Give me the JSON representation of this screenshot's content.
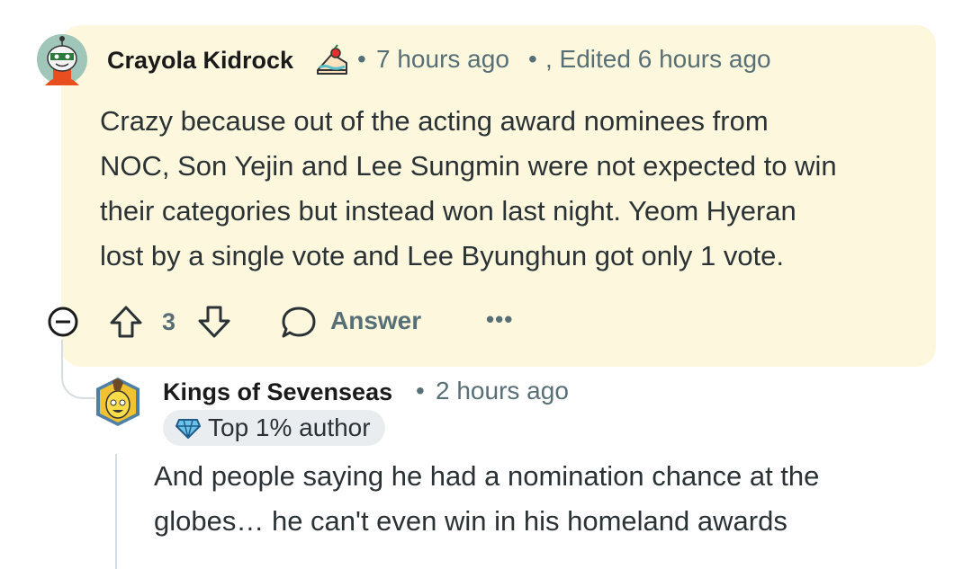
{
  "comment": {
    "author": "Crayola Kidrock",
    "separator": "•",
    "time": "7 hours ago",
    "edited": ", Edited 6 hours ago",
    "body_lines": [
      "Crazy because out of the acting award nominees from",
      "NOC, Son Yejin and Lee Sungmin were not expected to win",
      "their categories but instead won last night. Yeom Hyeran",
      "lost by a single vote and Lee Byunghun got only 1 vote."
    ],
    "vote_count": "3",
    "answer_label": "Answer",
    "more_label": "•••",
    "highlight_color": "#fdf7dd"
  },
  "reply": {
    "author": "Kings of Sevenseas",
    "separator": "•",
    "time": "2 hours ago",
    "badge": "Top 1% author",
    "body_lines": [
      "And people saying he had a nomination chance at the",
      "globes… he can't even win in his homeland awards"
    ]
  }
}
